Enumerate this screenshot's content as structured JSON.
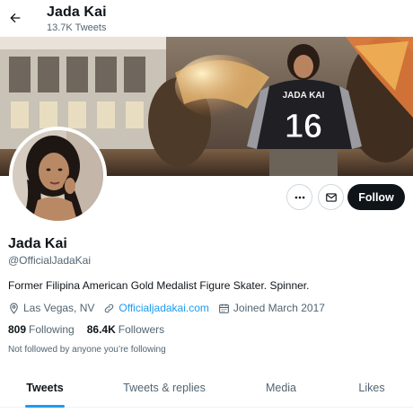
{
  "header": {
    "back_icon": "arrow-left-icon",
    "name": "Jada Kai",
    "tweet_count": "13.7K Tweets"
  },
  "banner": {
    "jacket_text": "JADA KAI",
    "jacket_number": "16"
  },
  "actions": {
    "more_icon": "more-dots-icon",
    "message_icon": "envelope-icon",
    "follow_label": "Follow"
  },
  "profile": {
    "display_name": "Jada Kai",
    "handle": "@OfficialJadaKai",
    "bio": "Former Filipina American Gold Medalist Figure Skater. Spinner.",
    "location": "Las Vegas, NV",
    "website": "Officialjadakai.com",
    "joined": "Joined March 2017",
    "following_count": "809",
    "following_label": "Following",
    "followers_count": "86.4K",
    "followers_label": "Followers",
    "not_followed_text": "Not followed by anyone you’re following"
  },
  "tabs": [
    {
      "label": "Tweets",
      "active": true
    },
    {
      "label": "Tweets & replies",
      "active": false
    },
    {
      "label": "Media",
      "active": false
    },
    {
      "label": "Likes",
      "active": false
    }
  ],
  "colors": {
    "accent": "#1d9bf0",
    "text": "#0f1419",
    "muted": "#536471",
    "follow_bg": "#0f1419"
  }
}
